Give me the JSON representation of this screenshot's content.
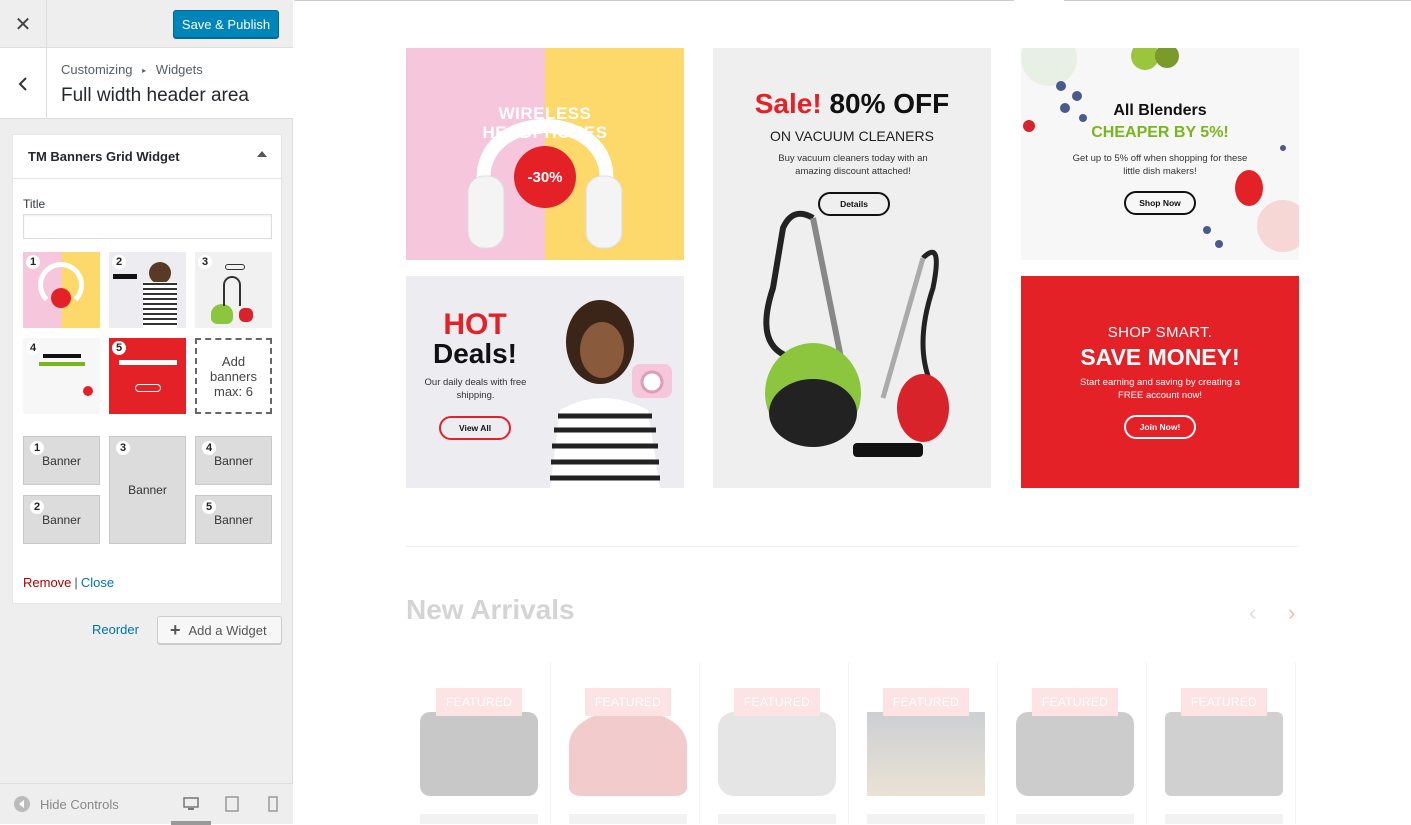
{
  "topbar": {
    "close_icon": "close-icon",
    "save_label": "Save & Publish"
  },
  "section": {
    "breadcrumb_parent": "Customizing",
    "breadcrumb_child": "Widgets",
    "title": "Full width header area"
  },
  "widget": {
    "title": "TM Banners Grid Widget",
    "title_label": "Title",
    "title_value": "",
    "thumbs": [
      "1",
      "2",
      "3",
      "4",
      "5"
    ],
    "add_banners": "Add banners max: 6",
    "slots": [
      {
        "num": "1",
        "label": "Banner"
      },
      {
        "num": "2",
        "label": "Banner"
      },
      {
        "num": "3",
        "label": "Banner"
      },
      {
        "num": "4",
        "label": "Banner"
      },
      {
        "num": "5",
        "label": "Banner"
      }
    ],
    "remove_label": "Remove",
    "separator": "|",
    "close_label": "Close"
  },
  "actions": {
    "reorder_label": "Reorder",
    "add_widget_label": "Add a Widget"
  },
  "footer": {
    "hide_controls_label": "Hide Controls"
  },
  "preview": {
    "banner1": {
      "line1": "WIRELESS",
      "line2": "HEADPHONES",
      "badge": "-30%"
    },
    "banner2": {
      "hot": "HOT",
      "deals": "Deals!",
      "desc": "Our daily deals with free shipping.",
      "button": "View All"
    },
    "banner3": {
      "sale": "Sale!",
      "off": "80% OFF",
      "sub": "ON VACUUM CLEANERS",
      "desc": "Buy vacuum cleaners today with an amazing discount attached!",
      "button": "Details"
    },
    "banner4": {
      "h1": "All Blenders",
      "h2": "CHEAPER BY 5%!",
      "desc": "Get up to 5% off when shopping for these little dish makers!",
      "button": "Shop Now"
    },
    "banner5": {
      "h1": "SHOP SMART.",
      "h2": "SAVE MONEY!",
      "desc": "Start earning and saving by creating a FREE account now!",
      "button": "Join Now!"
    },
    "new_arrivals_title": "New Arrivals",
    "products": [
      {
        "badge": "FEATURED"
      },
      {
        "badge": "FEATURED"
      },
      {
        "badge": "FEATURED"
      },
      {
        "badge": "FEATURED"
      },
      {
        "badge": "FEATURED"
      },
      {
        "badge": "FEATURED"
      }
    ]
  },
  "colors": {
    "accent": "#0085ba",
    "brand_red": "#e52128",
    "brand_green": "#7ab51d",
    "link": "#0073aa",
    "remove": "#aa0000"
  }
}
